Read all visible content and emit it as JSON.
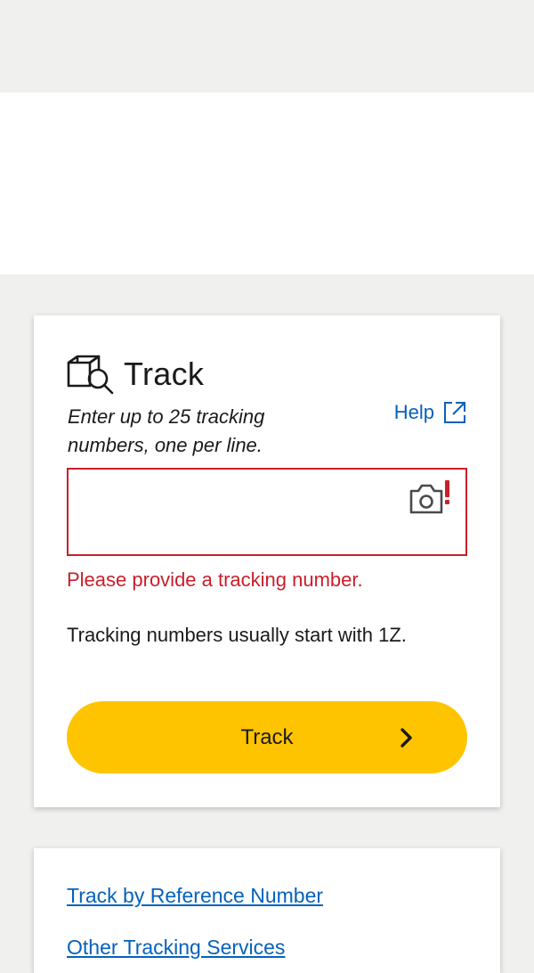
{
  "track_card": {
    "icon": "package-search-icon",
    "title": "Track",
    "instructions": "Enter up to 25 tracking numbers, one per line.",
    "help_label": "Help",
    "help_icon": "external-link-icon",
    "input_value": "",
    "input_placeholder": "",
    "camera_icon": "camera-icon",
    "error_icon": "exclamation-icon",
    "error_message": "Please provide a tracking number.",
    "hint": "Tracking numbers usually start with 1Z.",
    "button_label": "Track",
    "button_icon": "chevron-right-icon"
  },
  "links_card": {
    "track_by_reference": "Track by Reference Number",
    "other_services": "Other Tracking Services"
  },
  "colors": {
    "page_background": "#f0f0ef",
    "card_background": "#ffffff",
    "accent_yellow": "#ffc400",
    "error_red": "#c91f2a",
    "link_blue": "#0662bb",
    "text": "#1a1a1a"
  }
}
